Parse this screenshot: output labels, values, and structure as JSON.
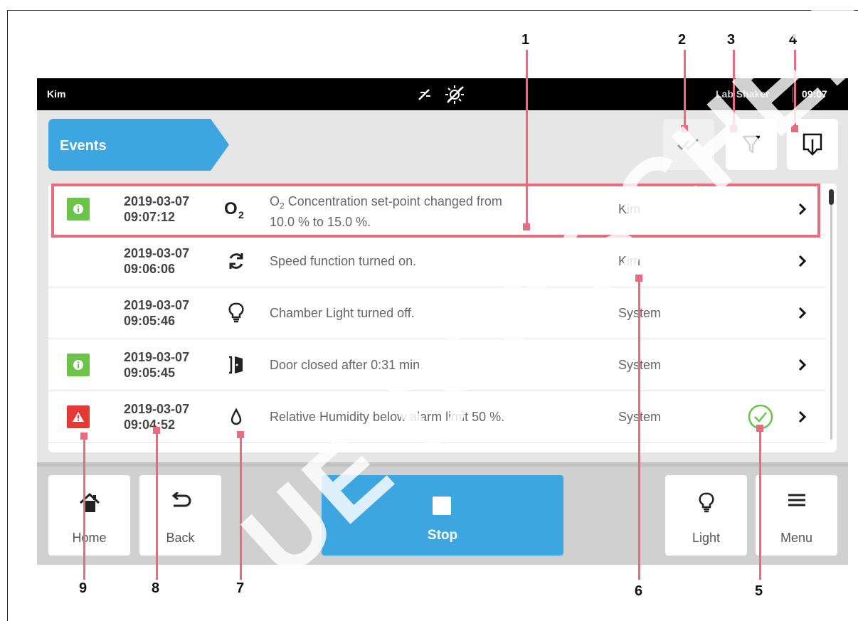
{
  "statusbar": {
    "user": "Kim",
    "device": "Lab Shaker",
    "time": "09:07",
    "icons": [
      "no-co2-icon",
      "no-temperature-icon"
    ]
  },
  "header": {
    "title": "Events",
    "buttons": [
      "acknowledge-all-icon",
      "filter-icon",
      "export-icon"
    ]
  },
  "events": [
    {
      "badge": "info",
      "date": "2019-03-07",
      "time": "09:07:12",
      "icon": "o2-icon",
      "message_pre": "O",
      "message_sub": "2",
      "message_rest": " Concentration set-point changed from",
      "message_line2": "10.0 % to 15.0 %.",
      "user": "Kim",
      "acknowledged": false
    },
    {
      "badge": "",
      "date": "2019-03-07",
      "time": "09:06:06",
      "icon": "speed-icon",
      "message": "Speed function turned on.",
      "user": "Kim",
      "acknowledged": false
    },
    {
      "badge": "",
      "date": "2019-03-07",
      "time": "09:05:46",
      "icon": "light-bulb-icon",
      "message": "Chamber Light turned off.",
      "user": "System",
      "acknowledged": false
    },
    {
      "badge": "info",
      "date": "2019-03-07",
      "time": "09:05:45",
      "icon": "door-icon",
      "message": "Door closed after 0:31 min.",
      "user": "System",
      "acknowledged": false
    },
    {
      "badge": "alarm",
      "date": "2019-03-07",
      "time": "09:04:52",
      "icon": "humidity-drop-icon",
      "message": "Relative Humidity below alarm limit 50 %.",
      "user": "System",
      "acknowledged": true
    }
  ],
  "bottom": {
    "home": "Home",
    "back": "Back",
    "stop": "Stop",
    "light": "Light",
    "menu": "Menu"
  },
  "callouts": [
    "1",
    "2",
    "3",
    "4",
    "5",
    "6",
    "7",
    "8",
    "9"
  ],
  "watermark": "VORSCHAU PREVIEW EPPENDORF DEUTSCHER",
  "colors": {
    "accent": "#3da5e0",
    "info": "#6cc24a",
    "alarm": "#e53935",
    "callout": "#e86b80"
  }
}
